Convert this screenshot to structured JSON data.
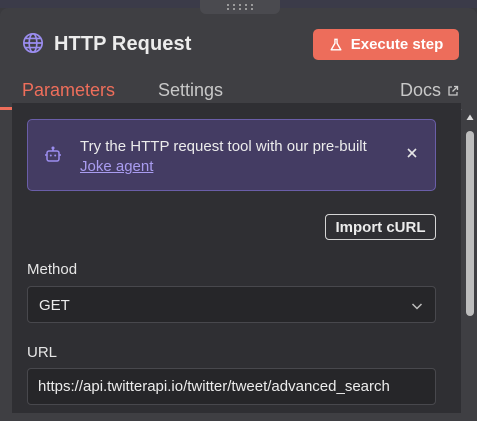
{
  "header": {
    "title": "HTTP Request",
    "execute_label": "Execute step",
    "icon": "globe-icon"
  },
  "tabs": [
    {
      "label": "Parameters",
      "active": true
    },
    {
      "label": "Settings",
      "active": false
    }
  ],
  "docs_label": "Docs",
  "callout": {
    "text": "Try the HTTP request tool with our pre-built ",
    "link": "Joke agent"
  },
  "import_label": "Import cURL",
  "method": {
    "label": "Method",
    "value": "GET"
  },
  "url": {
    "label": "URL",
    "value": "https://api.twitterapi.io/twitter/tweet/advanced_search"
  },
  "colors": {
    "accent": "#ee6e5b",
    "callout_bg": "#443c63",
    "link": "#a99cf0"
  }
}
